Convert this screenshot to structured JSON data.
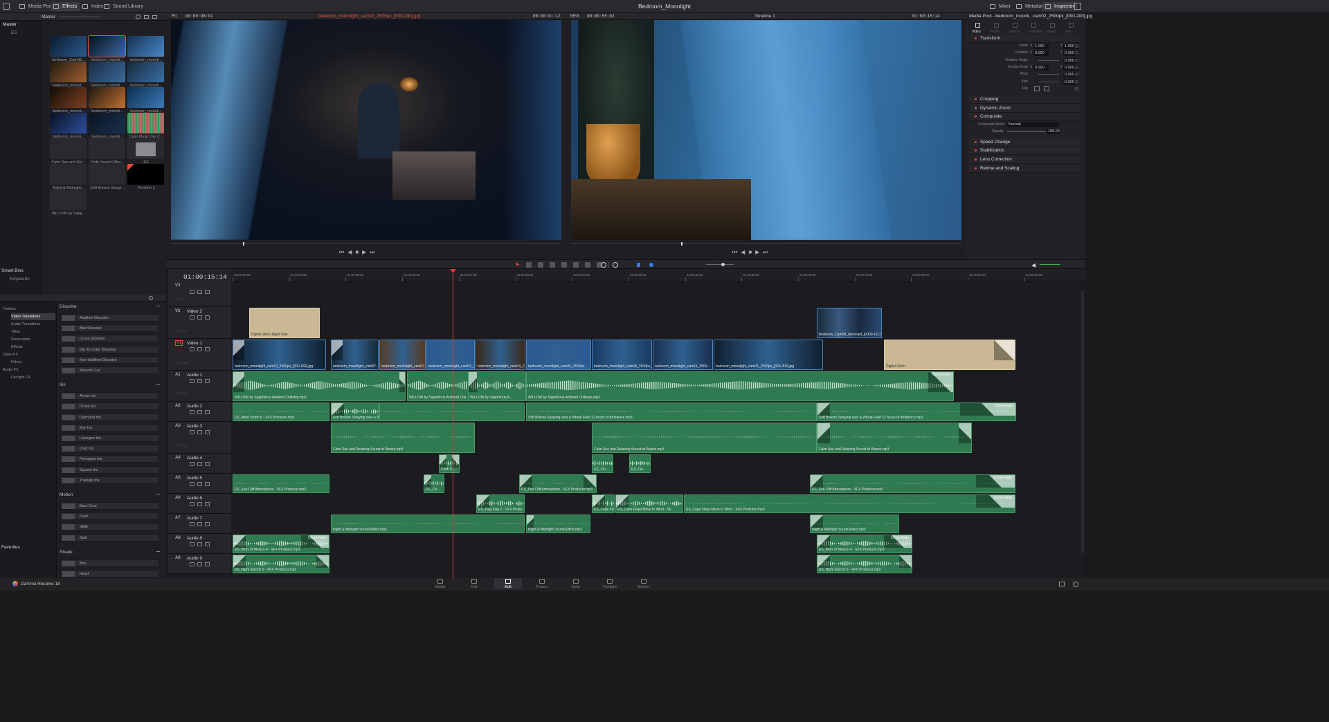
{
  "app": {
    "name": "DaVinci Resolve 18",
    "project_title": "Bedroom_Moonlight"
  },
  "topbar": {
    "left": [
      {
        "label": "Media Pool",
        "icon": "media-pool-icon",
        "active": false
      },
      {
        "label": "Effects",
        "icon": "effects-icon",
        "active": true
      },
      {
        "label": "Index",
        "icon": "index-icon",
        "active": false
      },
      {
        "label": "Sound Library",
        "icon": "sound-library-icon",
        "active": false
      }
    ],
    "right": [
      {
        "label": "Mixer",
        "icon": "mixer-icon"
      },
      {
        "label": "Metadata",
        "icon": "metadata-icon"
      },
      {
        "label": "Inspector",
        "icon": "inspector-icon"
      }
    ]
  },
  "media_pool": {
    "bin": "Master",
    "tree": [
      "Master",
      "ES"
    ],
    "smart_bins": "Smart Bins",
    "smart_items": [
      "Keywords"
    ],
    "clips": [
      "bedroom_Cam08...",
      "bedroom_moonli...",
      "bedroom_moonli...",
      "bedroom_moonli...",
      "bedroom_moonli...",
      "bedroom_moonli...",
      "bedroom_moonli...",
      "bedroom_moonli...",
      "bedroom_moonli...",
      "bedroom_moonli...",
      "bedroom_moonli...",
      "Calm Music (No C...",
      "Calm Sea and Rel...",
      "Cloth Sound Effec...",
      "ES",
      "Night & Midnight...",
      "Soft Breeze Swayi...",
      "Timeline 1",
      "WILLOW by Sapp..."
    ]
  },
  "viewer_left": {
    "fit": "Fit",
    "timecode_start": "00:00:08:01",
    "clip_name": "bedroom_moonlight_cam02_2500px_[000-200].jpg",
    "timecode_current": "00:00:01:12"
  },
  "viewer_right": {
    "zoom": "55%",
    "timecode_start": "00:00:55:02",
    "timeline": "Timeline 1",
    "timecode_current": "01:00:15:14"
  },
  "inspector": {
    "header": "Media Pool - bedroom_moonli...cam02_2500px_[000-200].jpg",
    "tabs": [
      "Video",
      "Audio",
      "Effects",
      "Transition",
      "Image",
      "File"
    ],
    "transform_title": "Transform",
    "rows": [
      {
        "label": "Zoom",
        "x": "1.000",
        "y": "1.000"
      },
      {
        "label": "Position",
        "x": "0.000",
        "y": "0.000"
      },
      {
        "label": "Rotation Angle",
        "v": "0.000"
      },
      {
        "label": "Anchor Point",
        "x": "0.000",
        "y": "0.000"
      },
      {
        "label": "Pitch",
        "v": "0.000"
      },
      {
        "label": "Yaw",
        "v": "0.000"
      },
      {
        "label": "Flip",
        "v": ""
      }
    ],
    "sections": [
      "Cropping",
      "Dynamic Zoom",
      "Composite",
      "Speed Change",
      "Stabilization",
      "Lens Correction",
      "Retime and Scaling"
    ],
    "composite_mode_label": "Composite Mode",
    "composite_mode": "Normal",
    "opacity_label": "Opacity",
    "opacity": "100.00"
  },
  "effects": {
    "toolbox": [
      {
        "label": "Toolbox",
        "level": 0
      },
      {
        "label": "Video Transitions",
        "level": 1,
        "selected": true
      },
      {
        "label": "Audio Transitions",
        "level": 1
      },
      {
        "label": "Titles",
        "level": 1
      },
      {
        "label": "Generators",
        "level": 1
      },
      {
        "label": "Effects",
        "level": 1
      },
      {
        "label": "Open FX",
        "level": 0
      },
      {
        "label": "Filters",
        "level": 1
      },
      {
        "label": "Audio FX",
        "level": 0
      },
      {
        "label": "Fairlight FX",
        "level": 1
      }
    ],
    "favorites": "Favorites",
    "groups": [
      {
        "title": "Dissolve",
        "items": [
          "Additive Dissolve",
          "Blur Dissolve",
          "Cross Dissolve",
          "Dip To Color Dissolve",
          "Non-Additive Dissolve",
          "Smooth Cut"
        ]
      },
      {
        "title": "Iris",
        "items": [
          "Arrow Iris",
          "Cross Iris",
          "Diamond Iris",
          "Eye Iris",
          "Hexagon Iris",
          "Oval Iris",
          "Pentagon Iris",
          "Square Iris",
          "Triangle Iris"
        ]
      },
      {
        "title": "Motion",
        "items": [
          "Barn Door",
          "Push",
          "Slide",
          "Split"
        ]
      },
      {
        "title": "Shape",
        "items": [
          "Box",
          "Heart"
        ]
      }
    ]
  },
  "timeline": {
    "timecode": "01:00:15:14",
    "ruler": [
      "01:00:00:00",
      "01:00:04:00",
      "01:00:08:00",
      "01:00:12:00",
      "01:00:16:00",
      "01:00:20:00",
      "01:00:24:00",
      "01:00:28:00",
      "01:00:32:00",
      "01:00:36:00",
      "01:00:40:00",
      "01:00:44:00",
      "01:00:48:00",
      "01:00:52:00",
      "01:00:56:00"
    ],
    "tracks": [
      {
        "id": "V3",
        "name": "",
        "clips_count": "0 Clip"
      },
      {
        "id": "V2",
        "name": "Video 2",
        "clips_count": "2 Clips"
      },
      {
        "id": "V1",
        "name": "Video 1",
        "clips_count": "11 Clips"
      },
      {
        "id": "A1",
        "name": "Audio 1",
        "clips_count": "5 Clips"
      },
      {
        "id": "A2",
        "name": "Audio 2",
        "clips_count": ""
      },
      {
        "id": "A3",
        "name": "Audio 3",
        "clips_count": "2 Clips"
      },
      {
        "id": "A4",
        "name": "Audio 4",
        "clips_count": ""
      },
      {
        "id": "A5",
        "name": "Audio 5",
        "clips_count": ""
      },
      {
        "id": "A6",
        "name": "Audio 6",
        "clips_count": ""
      },
      {
        "id": "A7",
        "name": "Audio 7",
        "clips_count": ""
      },
      {
        "id": "A8",
        "name": "Audio 8",
        "clips_count": ""
      },
      {
        "id": "A9",
        "name": "Audio 9",
        "clips_count": ""
      }
    ],
    "clip_labels": {
      "v2a": "Digital Glitch Right Side",
      "v2b": "Bedroom_Cam08_denoised_[0000-1117].jpg",
      "v1": [
        "bedroom_moonlight_cam12_2500px_[000-182].jpg",
        "bedroom_moonlight_cam07...",
        "bedroom_moonlight_cam02...",
        "bedroom_moonlight_cam03_2...",
        "bedroom_moonlight_cam04_2...",
        "bedroom_moonlight_cam06_2500px...",
        "bedroom_moonlight_cam08_2500px_[000-...",
        "bedroom_moonlight_cam11_2500...",
        "bedroom_moonlight_cam01_2500px_[000-200].jpg"
      ],
      "v1c": "Digital Glitch",
      "a1": "WILLOW by Sapphirrus Ambient Chillstep.mp3",
      "a1b": "WILLOW by Sapphirrus Ambient Chil...",
      "a1c": "WILLOW by Sapphirrus A...",
      "cross_fade": "Cross Fade",
      "a2a": "ES_Wind Storm 8 - SFX Producer.mp3",
      "a2b": "Soft Breeze Swaying over a W...",
      "a2c": "Soft Breeze Swaying over a Wheat Field 12 hours of Ambience.mp3",
      "a3": "Calm Sea and Relaxing Sound of Waves.mp3",
      "a4a": "Cloth S...",
      "a4b": "ES_Clo...",
      "a5": "ES_Sea Cliff Atmosphere - SFX Producer.mp3",
      "a5b": "ES_Clo...",
      "a6a": "ES_Flag Flap 2 - SFX Produ...",
      "a6b": "ES_Cape Flap...",
      "a6c": "ES_Cape Flaps Move In Wind - SF...",
      "a6d": "ES_Cape Flaps Move In Wind - SFX Producer.mp3",
      "a7": "Night & Midnight Sound Effect.mp3",
      "a8": "ES_Birds of Mexico 4 - SFX Producer.mp3",
      "a9": "ES_Night Insects 5 - SFX Producer.mp3"
    }
  },
  "pages": [
    "Media",
    "Cut",
    "Edit",
    "Fusion",
    "Color",
    "Fairlight",
    "Deliver"
  ],
  "active_page": "Edit"
}
